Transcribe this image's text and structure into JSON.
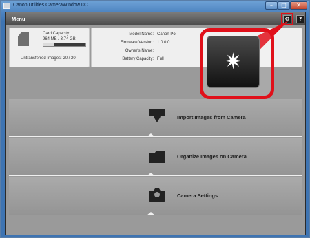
{
  "window": {
    "title": "Canon Utilities CameraWindow DC",
    "minimize_glyph": "–",
    "maximize_glyph": "□",
    "close_glyph": "✕"
  },
  "menubar": {
    "title": "Menu",
    "settings_icon": "⚙",
    "help_label": "?"
  },
  "card": {
    "capacity_label": "Card Capacity:",
    "capacity_value": "964 MB / 3.74 GB",
    "used_fraction": 0.25,
    "untransferred": "Untransferred Images: 20 / 20"
  },
  "camera_info": {
    "model_label": "Model Name:",
    "model_value": "Canon Po",
    "firmware_label": "Firmware Version:",
    "firmware_value": "1.0.0.0",
    "owner_label": "Owner's Name:",
    "owner_value": "",
    "battery_label": "Battery Capacity:",
    "battery_value": "Full"
  },
  "callout": {
    "icon": "gear-icon",
    "glyph": "✷",
    "color": "#e0101a"
  },
  "options": [
    {
      "label": "Import Images from Camera",
      "icon": "import-icon"
    },
    {
      "label": "Organize Images on Camera",
      "icon": "organize-icon"
    },
    {
      "label": "Camera Settings",
      "icon": "camera-icon"
    }
  ]
}
